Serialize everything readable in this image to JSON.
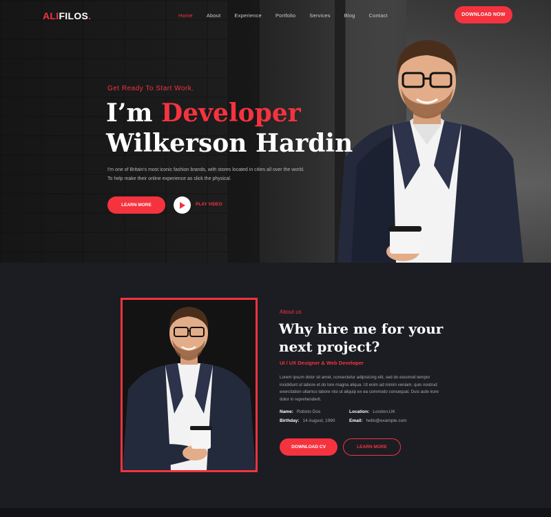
{
  "brand": {
    "part1": "ALI",
    "part2": "FILOS",
    "dot": "."
  },
  "nav": {
    "items": [
      "Home",
      "About",
      "Experience",
      "Portfolio",
      "Services",
      "Blog",
      "Contact"
    ],
    "cta": "DOWNLOAD NOW"
  },
  "hero": {
    "tagline": "Get Ready To Start Work.",
    "intro": "I’m",
    "role": "Developer",
    "name": "Wilkerson Hardin",
    "description": "I'm one of Britain's most iconic fashion brands, with stores located in cities all over the world. To help make their online experience as slick the physical.",
    "learn_more": "LEARN MORE",
    "play_video": "PLAY VIDEO"
  },
  "about": {
    "label": "About us",
    "title": "Why hire me for your next project?",
    "subtitle": "UI / UX Designer & Web Developer",
    "description": "Lorem ipsum dolor sit amet, consectetur adipisicing elit, sed do eiusmod tempor incididunt ut labore et do lore magna aliqua. Ut enim ad minim veniam, quis nostrud exercitation ullamco labore nisi ut aliquip ex ea commodo consequat. Duis aute irure dolor in reprehenderit.",
    "info": {
      "name_label": "Name:",
      "name": "Roboto Dos",
      "location_label": "Location:",
      "location": "London,UK",
      "birthday_label": "Birthday:",
      "birthday": "14 August, 1990",
      "email_label": "Email:",
      "email": "hello@example.com"
    },
    "download_cv": "DOWNLOAD CV",
    "learn_more": "LEARN MORE"
  },
  "colors": {
    "accent": "#f5333f",
    "bg_dark": "#1b1d22"
  }
}
